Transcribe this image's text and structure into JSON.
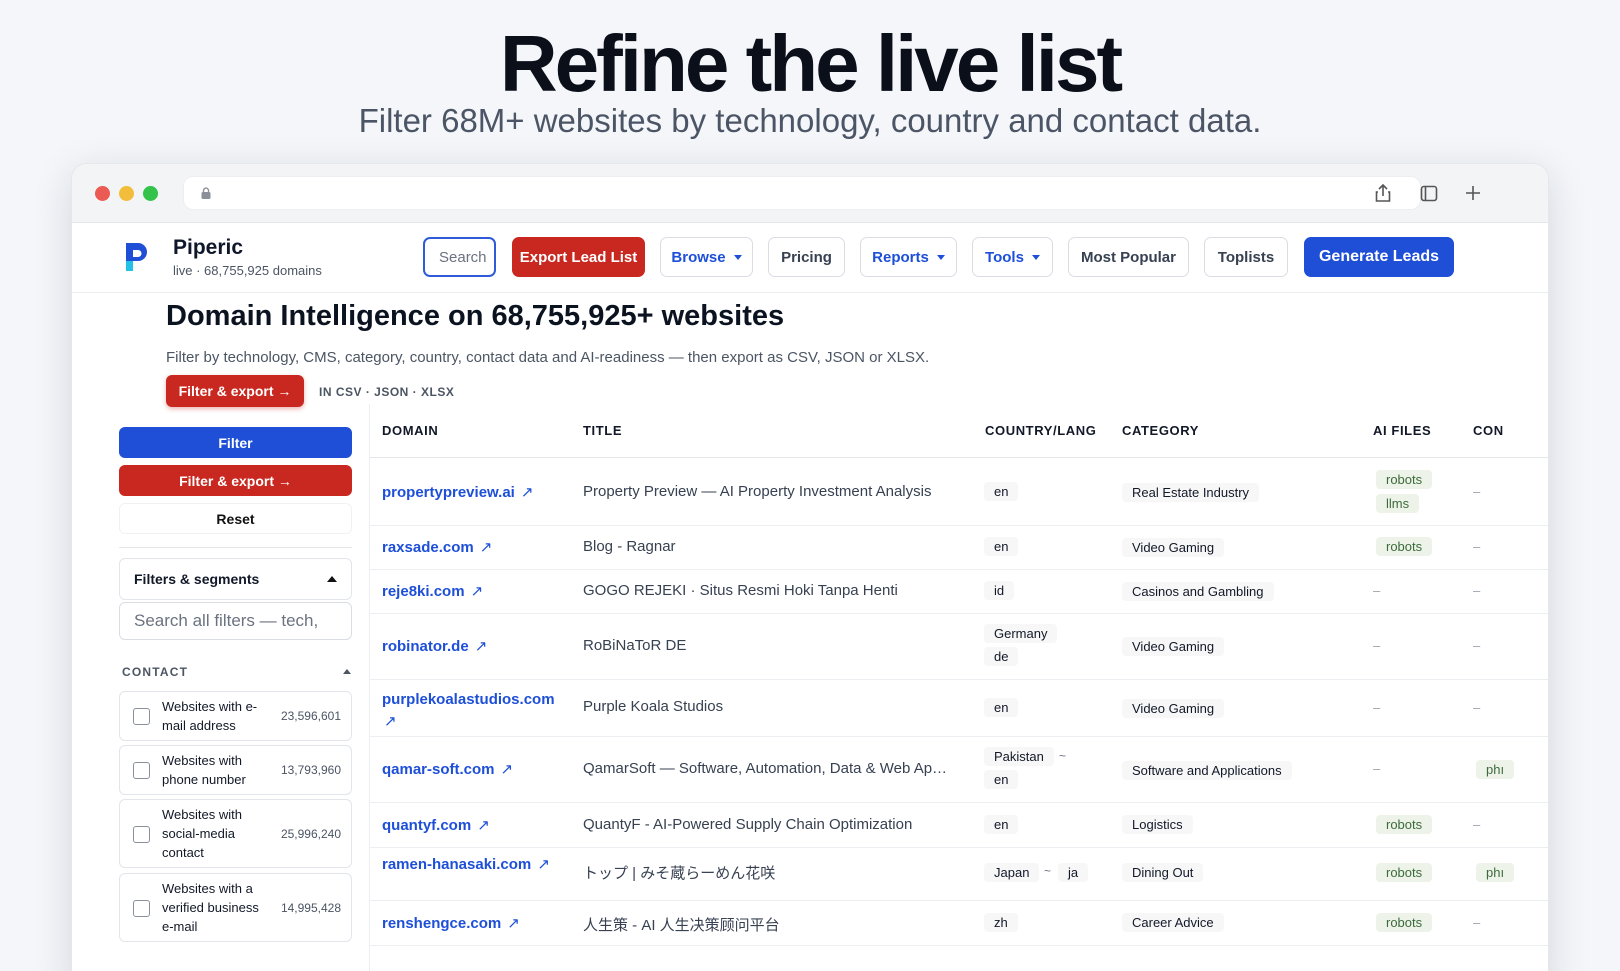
{
  "hero": {
    "title": "Refine the live list",
    "subtitle": "Filter 68M+ websites by technology, country and contact data."
  },
  "icons": [
    "lock-icon",
    "share-icon",
    "tabs-icon",
    "plus-icon",
    "logo-icon",
    "external-link-icon",
    "checkbox-icon"
  ],
  "brand": {
    "name": "Piperic",
    "sub": "live · 68,755,925 domains",
    "color": "#1f4fd6"
  },
  "nav": {
    "search_placeholder": "Search",
    "export": "Export Lead List",
    "browse": "Browse",
    "pricing": "Pricing",
    "reports": "Reports",
    "tools": "Tools",
    "popular": "Most Popular",
    "toplists": "Toplists",
    "generate": "Generate Leads"
  },
  "header": {
    "title": "Domain Intelligence on 68,755,925+ websites",
    "lead": "Filter by technology, CMS, category, country, contact data and AI-readiness — then export as CSV, JSON or XLSX.",
    "cta": "Filter & export →",
    "formats": "IN CSV · JSON · XLSX"
  },
  "sidebar": {
    "filter": "Filter",
    "filter_export": "Filter & export →",
    "reset": "Reset",
    "segments": "Filters & segments",
    "search_placeholder": "Search all filters — tech,",
    "contact_label": "CONTACT",
    "items": [
      {
        "label": "Websites with e-mail address",
        "count": "23,596,601"
      },
      {
        "label": "Websites with phone number",
        "count": "13,793,960"
      },
      {
        "label": "Websites with social-media contact",
        "count": "25,996,240"
      },
      {
        "label": "Websites with a verified business e-mail",
        "count": "14,995,428"
      }
    ]
  },
  "table": {
    "columns": [
      "DOMAIN",
      "TITLE",
      "COUNTRY/LANG",
      "CATEGORY",
      "AI FILES",
      "CON"
    ],
    "rows": [
      {
        "domain": "propertypreview.ai",
        "title": "Property Preview — AI Property Investment Analysis",
        "country": "",
        "lang": "en",
        "category": "Real Estate Industry",
        "ai": [
          "robots",
          "llms"
        ],
        "contact": "–"
      },
      {
        "domain": "raxsade.com",
        "title": "Blog - Ragnar",
        "country": "",
        "lang": "en",
        "category": "Video Gaming",
        "ai": [
          "robots"
        ],
        "contact": "–"
      },
      {
        "domain": "reje8ki.com",
        "title": "GOGO REJEKI · Situs Resmi Hoki Tanpa Henti",
        "country": "",
        "lang": "id",
        "category": "Casinos and Gambling",
        "ai": [],
        "contact": "–"
      },
      {
        "domain": "robinator.de",
        "title": "RoBiNaToR DE",
        "country": "Germany",
        "lang": "de",
        "category": "Video Gaming",
        "ai": [],
        "contact": "–"
      },
      {
        "domain": "purplekoalastudios.com",
        "title": "Purple Koala Studios",
        "country": "",
        "lang": "en",
        "category": "Video Gaming",
        "ai": [],
        "contact": "–"
      },
      {
        "domain": "qamar-soft.com",
        "title": "QamarSoft — Software, Automation, Data & Web Ap…",
        "country": "Pakistan",
        "lang": "en",
        "category": "Software and Applications",
        "ai": [],
        "contact": "phı"
      },
      {
        "domain": "quantyf.com",
        "title": "QuantyF - AI-Powered Supply Chain Optimization",
        "country": "",
        "lang": "en",
        "category": "Logistics",
        "ai": [
          "robots"
        ],
        "contact": "–"
      },
      {
        "domain": "ramen-hanasaki.com",
        "title": "トップ | みそ蔵らーめん花咲",
        "country": "Japan",
        "lang": "ja",
        "category": "Dining Out",
        "ai": [
          "robots"
        ],
        "contact": "phı"
      },
      {
        "domain": "renshengce.com",
        "title": "人生策 - AI 人生决策顾问平台",
        "country": "",
        "lang": "zh",
        "category": "Career Advice",
        "ai": [
          "robots"
        ],
        "contact": "–"
      }
    ],
    "tilde": "~",
    "ext_arrow": "↗",
    "dash": "–"
  }
}
